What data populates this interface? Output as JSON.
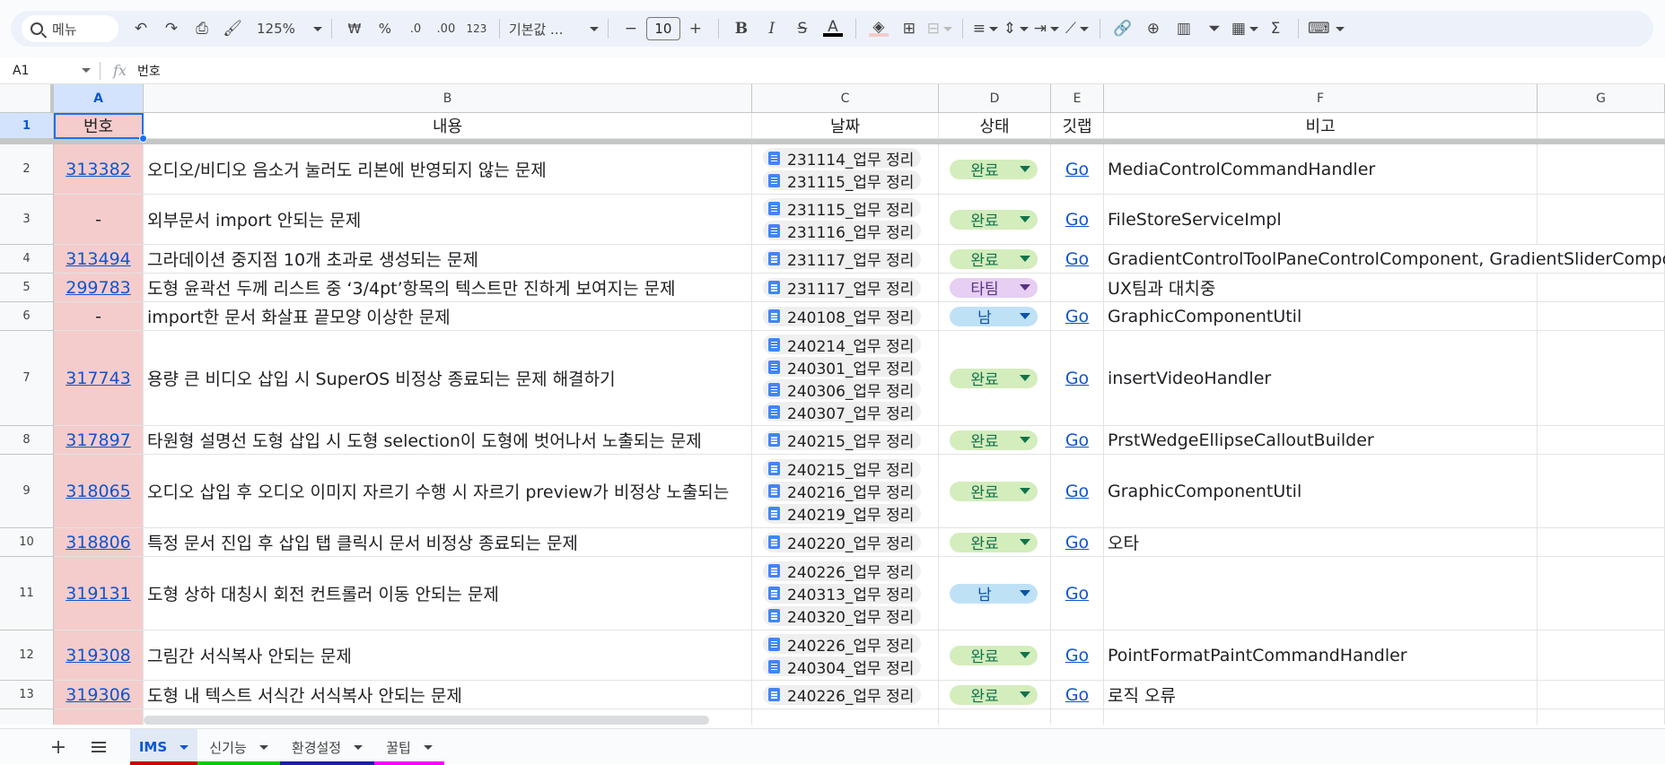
{
  "toolbar": {
    "search_placeholder": "메뉴",
    "zoom": "125%",
    "currency": "₩",
    "percent": "%",
    "dec_decrease": ".0",
    "dec_increase": ".00",
    "number_format": "123",
    "font": "기본값 ...",
    "font_size": "10",
    "minus": "−",
    "plus": "+"
  },
  "formula_bar": {
    "cell_ref": "A1",
    "fx": "fx",
    "value": "번호"
  },
  "columns": [
    "A",
    "B",
    "C",
    "D",
    "E",
    "F",
    "G"
  ],
  "header_row": {
    "number": "1",
    "cells": [
      "번호",
      "내용",
      "날짜",
      "상태",
      "깃랩",
      "비고",
      ""
    ]
  },
  "rows": [
    {
      "n": "2",
      "id": "313382",
      "content": "오디오/비디오 음소거 눌러도 리본에 반영되지 않는 문제",
      "dates": [
        "231114_업무 정리",
        "231115_업무 정리"
      ],
      "status": "완료",
      "status_type": "done",
      "gitlab": "Go",
      "note": "MediaControlCommandHandler"
    },
    {
      "n": "3",
      "id": "-",
      "content": "외부문서 import 안되는 문제",
      "dates": [
        "231115_업무 정리",
        "231116_업무 정리"
      ],
      "status": "완료",
      "status_type": "done",
      "gitlab": "Go",
      "note": "FileStoreServiceImpl"
    },
    {
      "n": "4",
      "id": "313494",
      "content": "그라데이션 중지점 10개 초과로 생성되는 문제",
      "dates": [
        "231117_업무 정리"
      ],
      "status": "완료",
      "status_type": "done",
      "gitlab": "Go",
      "note": "GradientControlToolPaneControlComponent, GradientSliderComponent"
    },
    {
      "n": "5",
      "id": "299783",
      "content": "도형 윤곽선 두께 리스트 중 ‘3/4pt’항목의 텍스트만 진하게 보여지는 문제",
      "dates": [
        "231117_업무 정리"
      ],
      "status": "타팀",
      "status_type": "other",
      "gitlab": "",
      "note": "UX팀과 대치중"
    },
    {
      "n": "6",
      "id": "-",
      "content": "import한 문서 화살표 끝모양 이상한 문제",
      "dates": [
        "240108_업무 정리"
      ],
      "status": "남",
      "status_type": "remain",
      "gitlab": "Go",
      "note": "GraphicComponentUtil"
    },
    {
      "n": "7",
      "id": "317743",
      "content": "용량 큰 비디오 삽입 시 SuperOS 비정상 종료되는 문제 해결하기",
      "dates": [
        "240214_업무 정리",
        "240301_업무 정리",
        "240306_업무 정리",
        "240307_업무 정리"
      ],
      "status": "완료",
      "status_type": "done",
      "gitlab": "Go",
      "note": "insertVideoHandler"
    },
    {
      "n": "8",
      "id": "317897",
      "content": "타원형 설명선 도형 삽입 시 도형 selection이 도형에 벗어나서 노출되는 문제",
      "dates": [
        "240215_업무 정리"
      ],
      "status": "완료",
      "status_type": "done",
      "gitlab": "Go",
      "note": "PrstWedgeEllipseCalloutBuilder"
    },
    {
      "n": "9",
      "id": "318065",
      "content": "오디오 삽입 후 오디오 이미지 자르기 수행 시 자르기 preview가 비정상 노출되는",
      "dates": [
        "240215_업무 정리",
        "240216_업무 정리",
        "240219_업무 정리"
      ],
      "status": "완료",
      "status_type": "done",
      "gitlab": "Go",
      "note": "GraphicComponentUtil"
    },
    {
      "n": "10",
      "id": "318806",
      "content": "특정 문서 진입 후 삽입 탭 클릭시 문서 비정상 종료되는 문제",
      "dates": [
        "240220_업무 정리"
      ],
      "status": "완료",
      "status_type": "done",
      "gitlab": "Go",
      "note": "오타"
    },
    {
      "n": "11",
      "id": "319131",
      "content": "도형 상하 대칭시 회전 컨트롤러 이동 안되는 문제",
      "dates": [
        "240226_업무 정리",
        "240313_업무 정리",
        "240320_업무 정리"
      ],
      "status": "남",
      "status_type": "remain",
      "gitlab": "Go",
      "note": ""
    },
    {
      "n": "12",
      "id": "319308",
      "content": "그림간 서식복사 안되는 문제",
      "dates": [
        "240226_업무 정리",
        "240304_업무 정리"
      ],
      "status": "완료",
      "status_type": "done",
      "gitlab": "Go",
      "note": "PointFormatPaintCommandHandler"
    },
    {
      "n": "13",
      "id": "319306",
      "content": "도형 내 텍스트 서식간 서식복사 안되는 문제",
      "dates": [
        "240226_업무 정리"
      ],
      "status": "완료",
      "status_type": "done",
      "gitlab": "Go",
      "note": "로직 오류"
    }
  ],
  "sheet_tabs": [
    {
      "label": "IMS",
      "active": true,
      "color": "#cc0000"
    },
    {
      "label": "신기능",
      "active": false,
      "color": "#00cc00"
    },
    {
      "label": "환경설정",
      "active": false,
      "color": "#1c1ca8"
    },
    {
      "label": "꿀팁",
      "active": false,
      "color": "#ff00ff"
    }
  ],
  "colors": {
    "accent": "#1a73e8",
    "id_column_fill": "#f4cccc",
    "status_done": "#d4edbc",
    "status_remain": "#bfe1f6",
    "status_other": "#e6cff2"
  }
}
